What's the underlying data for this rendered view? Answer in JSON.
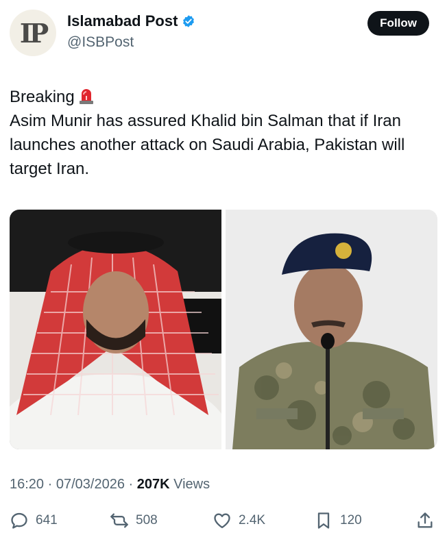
{
  "account": {
    "avatar_logo_text": "IP",
    "display_name": "Islamabad Post",
    "handle": "@ISBPost",
    "verified": true,
    "verified_color": "#1d9bf0"
  },
  "follow_label": "Follow",
  "tweet": {
    "line1": "Breaking",
    "siren_icon": "police-siren-icon",
    "body": "Asim Munir has assured Khalid bin Salman that if Iran launches another attack on Saudi Arabia, Pakistan will target Iran."
  },
  "meta": {
    "time": "16:20",
    "date": "07/03/2026",
    "views_count": "207K",
    "views_label": "Views"
  },
  "actions": {
    "replies": "641",
    "reposts": "508",
    "likes": "2.4K",
    "bookmarks": "120"
  },
  "colors": {
    "text": "#0f1419",
    "muted": "#536471",
    "button_bg": "#0f1419"
  }
}
